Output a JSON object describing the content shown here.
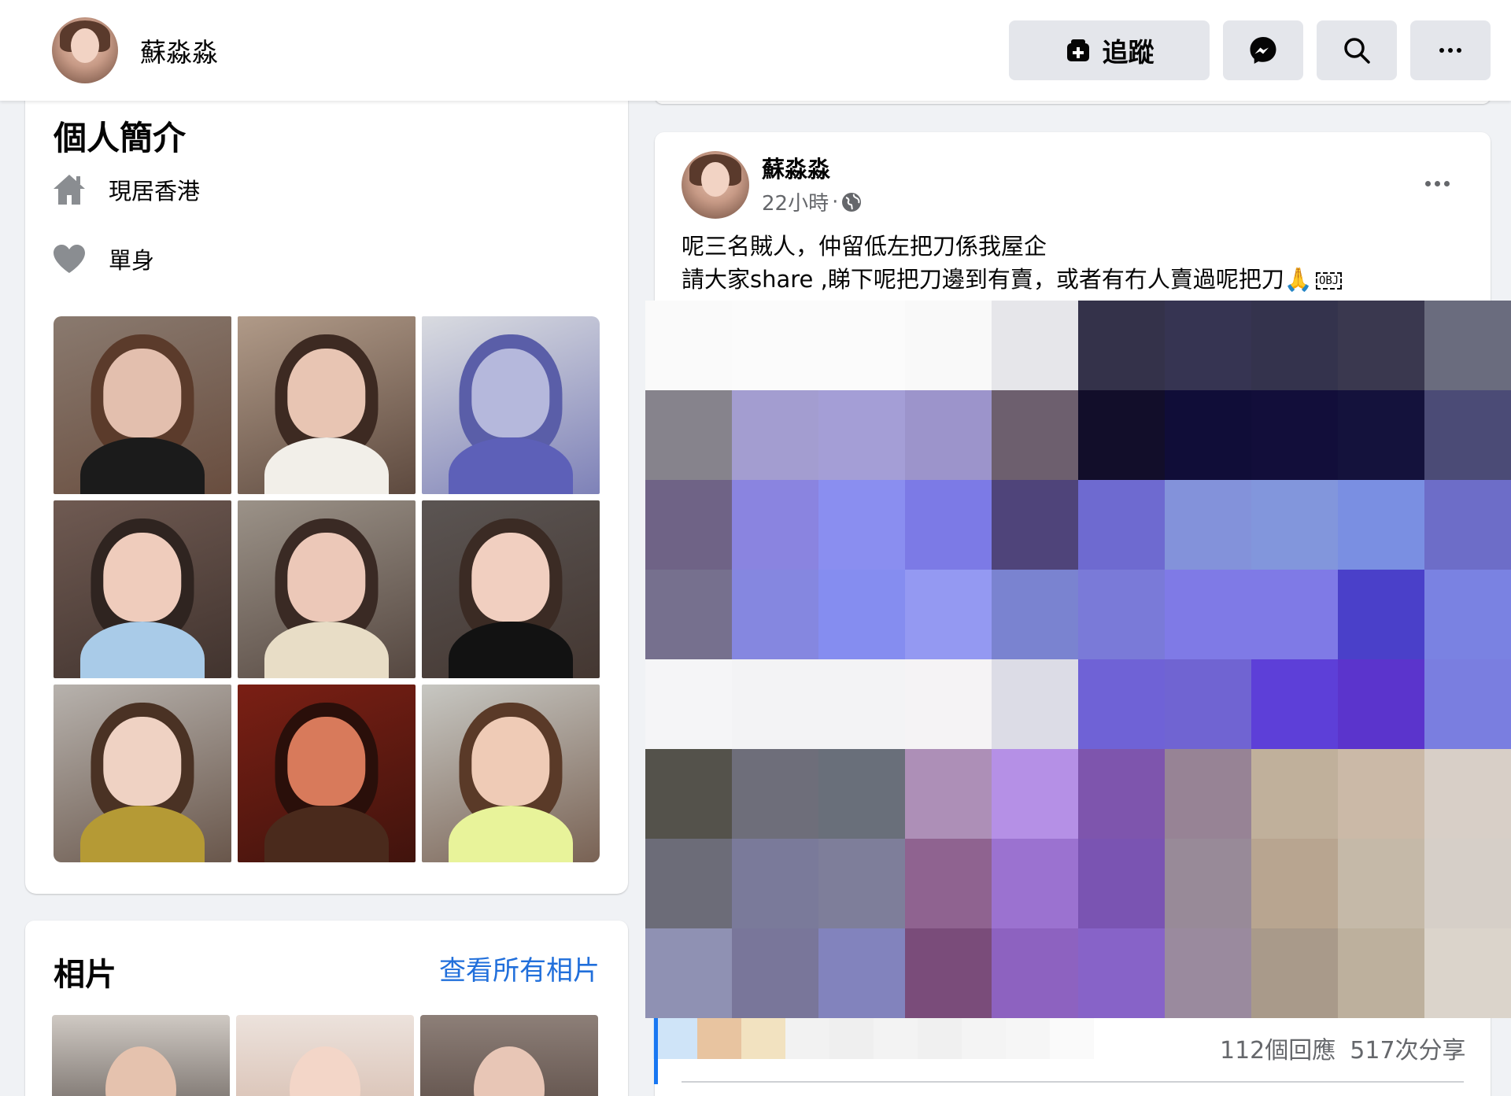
{
  "header": {
    "name": "蘇淼淼",
    "follow_label": "追蹤"
  },
  "intro": {
    "title": "個人簡介",
    "lives_in": "現居香港",
    "relationship": "單身",
    "photos": [
      {
        "label": "photo-1",
        "bg": "#8a7a6f",
        "skin": "#e3bfae",
        "hair": "#5b3b2b",
        "top": "#1b1b1b"
      },
      {
        "label": "photo-2",
        "bg": "#b09a88",
        "skin": "#e8c5b3",
        "hair": "#3d2a22",
        "top": "#f2efe9"
      },
      {
        "label": "photo-3",
        "bg": "#d9dbe0",
        "skin": "#b5b8dc",
        "hair": "#5a5ea8",
        "top": "#5d60b8"
      },
      {
        "label": "photo-4",
        "bg": "#6f5a52",
        "skin": "#efccbc",
        "hair": "#2f2420",
        "top": "#a9cbe8"
      },
      {
        "label": "photo-5",
        "bg": "#9b9288",
        "skin": "#ecc8b8",
        "hair": "#3a2a24",
        "top": "#e8ddc6"
      },
      {
        "label": "photo-6",
        "bg": "#5b5553",
        "skin": "#f1cfc0",
        "hair": "#3b2b24",
        "top": "#121212"
      },
      {
        "label": "photo-7",
        "bg": "#b7b2ad",
        "skin": "#efd2c3",
        "hair": "#4a3224",
        "top": "#b59a35"
      },
      {
        "label": "photo-8",
        "bg": "#7a1f14",
        "skin": "#d87a5b",
        "hair": "#2a0f0a",
        "top": "#4a2a1c"
      },
      {
        "label": "photo-9",
        "bg": "#c7c7c2",
        "skin": "#efcbb6",
        "hair": "#5a3a28",
        "top": "#e8f39a"
      }
    ]
  },
  "photos_section": {
    "title": "相片",
    "see_all": "查看所有相片",
    "strip": [
      {
        "bg": "#cfc9c3",
        "skin": "#e5c2ae",
        "hair": "#2a211d"
      },
      {
        "bg": "#ece2dc",
        "skin": "#f3d6c8",
        "hair": "#c9a592"
      },
      {
        "bg": "#8d7f78",
        "skin": "#e8c6b6",
        "hair": "#3a2a24"
      }
    ]
  },
  "post": {
    "author": "蘇淼淼",
    "time": "22小時",
    "line1": "呢三名賊人，仲留低左把刀係我屋企",
    "line2": "請大家share ,睇下呢把刀邊到有賣，或者有冇人賣過呢把刀🙏",
    "obj_glyph": "OBJ",
    "reactions": "112個回應",
    "shares": "517次分享"
  },
  "mosaic": {
    "cells": [
      "#fafafa",
      "#fbfbfb",
      "#fbfbfb",
      "#f9f9f9",
      "#e6e6ea",
      "#34324a",
      "#363452",
      "#34334d",
      "#3a384f",
      "#6a6c7e",
      "#86838c",
      "#a39dd0",
      "#a49ed6",
      "#9c94cb",
      "#6d5f6e",
      "#120e2a",
      "#100d38",
      "#120e3a",
      "#14123c",
      "#4b4b76",
      "#6f6386",
      "#8a84e0",
      "#8a8ef0",
      "#7c7ae6",
      "#4f447a",
      "#6e6ad0",
      "#8392da",
      "#8296dc",
      "#7a8fe2",
      "#6d6dc8",
      "#76708e",
      "#8587e0",
      "#858df0",
      "#9499f2",
      "#7a83d0",
      "#7a7ad8",
      "#7f7ae6",
      "#7f7ae6",
      "#4a40c9",
      "#7a82e2",
      "#f5f5f7",
      "#f3f3f5",
      "#f3f3f5",
      "#f5f3f5",
      "#dcdce6",
      "#6f62d6",
      "#7064d2",
      "#5d3fd8",
      "#5b34cc",
      "#7a7ee0",
      "#54524b",
      "#6e6e7a",
      "#696f7a",
      "#ad8fb7",
      "#b590e6",
      "#7e55ad",
      "#978395",
      "#c0b09b",
      "#cbb9a7",
      "#d8cfc7",
      "#6c6c78",
      "#7a7a9a",
      "#7e7e9a",
      "#8f6390",
      "#9b72d0",
      "#7a54b2",
      "#988a98",
      "#b8a590",
      "#c5b9a8",
      "#d6cfc8",
      "#8f91b3",
      "#79769a",
      "#8283bd",
      "#7a4c7a",
      "#8d62c0",
      "#8763c8",
      "#9a8a9e",
      "#a99a8a",
      "#bdb09d",
      "#dbd4cb"
    ],
    "strip": [
      "#cfe4f8",
      "#e8c4a0",
      "#f2e2c0",
      "#f2f2f2",
      "#efefef",
      "#f3f3f3",
      "#f0f0f0",
      "#f4f4f4",
      "#f6f6f6",
      "#fafafa"
    ]
  },
  "colors": {
    "accent": "#1877f2",
    "link": "#216fdb",
    "muted": "#65676b",
    "button_bg": "#e4e6eb"
  },
  "icons": {
    "follow": "user-plus-icon",
    "messenger": "messenger-icon",
    "search": "search-icon",
    "more": "more-horizontal-icon",
    "home": "home-icon",
    "heart": "heart-icon",
    "globe": "globe-icon"
  }
}
